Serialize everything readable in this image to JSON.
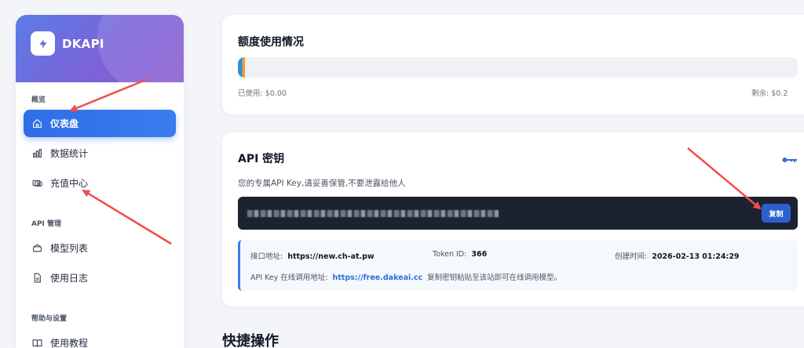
{
  "brand": {
    "name": "DKAPI",
    "logo_icon": "bolt-icon"
  },
  "sidebar": {
    "sections": [
      {
        "label": "概览",
        "items": [
          {
            "label": "仪表盘",
            "icon": "home-icon",
            "active": true
          },
          {
            "label": "数据统计",
            "icon": "bar-chart-icon"
          },
          {
            "label": "充值中心",
            "icon": "wallet-icon"
          }
        ]
      },
      {
        "label": "API 管理",
        "items": [
          {
            "label": "模型列表",
            "icon": "layers-icon"
          },
          {
            "label": "使用日志",
            "icon": "document-icon"
          }
        ]
      },
      {
        "label": "帮助与设置",
        "items": [
          {
            "label": "使用教程",
            "icon": "book-icon"
          }
        ]
      }
    ]
  },
  "quota": {
    "title": "额度使用情况",
    "used_label": "已使用: $0.00",
    "remaining_label": "剩余: $0.2",
    "progress_fraction": 0.01
  },
  "api_key": {
    "title": "API 密钥",
    "description": "您的专属API Key,请妥善保管,不要泄露给他人",
    "copy_label": "复制",
    "endpoint_label": "接口地址:",
    "endpoint_value": "https://new.ch-at.pw",
    "token_id_label": "Token ID:",
    "token_id_value": "366",
    "created_label": "创建时间:",
    "created_value": "2026-02-13 01:24:29",
    "online_label": "API Key 在线调用地址:",
    "online_url": "https://free.dakeai.cc",
    "online_hint": "复制密钥粘贴至该站即可在线调用模型。"
  },
  "shortcuts": {
    "title": "快捷操作"
  },
  "colors": {
    "accent": "#2f6ee6",
    "brand_gradient_start": "#5b7ce6",
    "brand_gradient_end": "#8a5ccf",
    "annotation_arrow": "#ee4f4f"
  }
}
